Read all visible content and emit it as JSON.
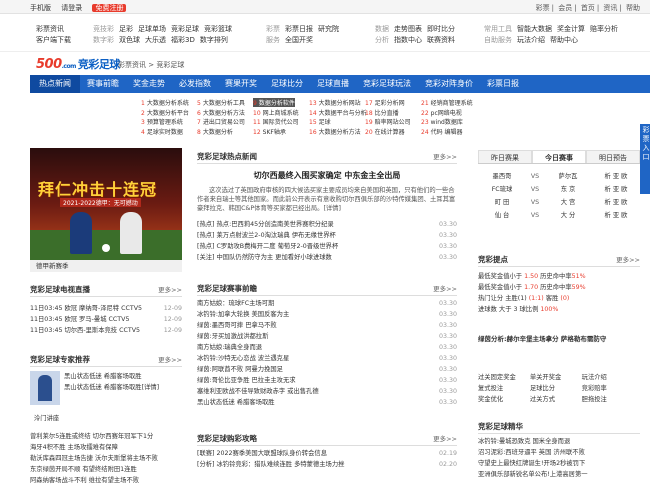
{
  "topbar": {
    "mobile": "手机版",
    "login": "请登录",
    "register": "免费注册",
    "right_links": [
      "彩票",
      "会员",
      "首页",
      "资讯",
      "帮助"
    ]
  },
  "nav2": {
    "g1": {
      "rows": [
        [
          "彩票资讯"
        ],
        [
          "客户端下载"
        ]
      ]
    },
    "g2": {
      "label": "竞技彩",
      "label2": "数字彩",
      "rows": [
        [
          "足彩",
          "足球单场",
          "竞彩足球",
          "竞彩篮球"
        ],
        [
          "双色球",
          "大乐透",
          "福彩3D",
          "数字排列"
        ]
      ]
    },
    "g3": {
      "label": "彩票",
      "label2": "服务",
      "rows": [
        [
          "彩票日报",
          "研究院"
        ],
        [
          "全国开奖"
        ]
      ]
    },
    "g4": {
      "label": "数据",
      "label2": "分析",
      "rows": [
        [
          "走势图表",
          "即时比分"
        ],
        [
          "指数中心",
          "联赛资料"
        ]
      ]
    },
    "g5": {
      "label": "常用工具",
      "label2": "自助服务",
      "rows": [
        [
          "智能大数据",
          "奖金计算",
          "赔率分析"
        ],
        [
          "玩法介绍",
          "帮助中心"
        ]
      ]
    }
  },
  "logo": {
    "num": "500",
    "suffix": ".com",
    "text": "竞彩足球"
  },
  "breadcrumb": "彩票资讯 > 竞彩足球",
  "mainnav": [
    "热点新闻",
    "赛事前瞻",
    "奖金走势",
    "必发指数",
    "赛果开奖",
    "足球比分",
    "足球直播",
    "竞彩足球玩法",
    "竞彩对阵身价",
    "彩票日报"
  ],
  "subgrid": [
    [
      "1",
      "大数据分析系统"
    ],
    [
      "5",
      "大数据分析工具"
    ],
    [
      "9",
      "数据分析软件"
    ],
    [
      "13",
      "大数据分析网站"
    ],
    [
      "17",
      "足彩分析网"
    ],
    [
      "21",
      "经销商管理系统"
    ],
    [
      "2",
      "大数据分析平台"
    ],
    [
      "6",
      "大数据分析方法"
    ],
    [
      "10",
      "网上商城系统"
    ],
    [
      "14",
      "大数据平台与分析"
    ],
    [
      "18",
      "比分直播"
    ],
    [
      "22",
      "pc网络电视"
    ],
    [
      "3",
      "预算管理系统"
    ],
    [
      "7",
      "进出口贸易公司"
    ],
    [
      "11",
      "国际货代公司"
    ],
    [
      "15",
      "足球"
    ],
    [
      "19",
      "赔率网站公司"
    ],
    [
      "23",
      "wind数据库"
    ],
    [
      "4",
      "足球实时数据"
    ],
    [
      "8",
      "大数据分析"
    ],
    [
      "12",
      "SKF轴承"
    ],
    [
      "16",
      "大数据分析方法"
    ],
    [
      "20",
      "在线计算器"
    ],
    [
      "24",
      "代码 编辑器"
    ]
  ],
  "side_right": "彩票入口",
  "banner": {
    "title": "拜仁冲击十连冠",
    "sub": "2021-2022德甲：无可撼动",
    "caption": "德甲新赛季"
  },
  "hotnews": {
    "title": "竞彩足球热点新闻",
    "more": "更多>>",
    "headline": "切尔西最终入围买家确定 中东金主全出局",
    "summary": "这次选过了英国政府审核的四大候选买家主要成员均来自美国和英国，只有他们的一些合作者来自瑞士等其他国家。而此前公开表示有意收购切尔西俱乐部的沙特传媒集团、土耳其富豪拜拉克、韩国C&P体育等买家都已经出局。[详情]",
    "items": [
      {
        "text": "[热点] 热点:巴西莉45分创造南美世界赛积分纪录",
        "date": "03.30"
      },
      {
        "text": "[热点] 莱万点射波兰2-0淘汰瑞典 伊布无缘世界杯",
        "date": "03.30"
      },
      {
        "text": "[热点] C罗助攻B费梅开二度 葡萄牙2-0晋级世界杯",
        "date": "03.30"
      },
      {
        "text": "[关注] 中国队仍然防守为主 更加看好小球进球数",
        "date": "03.30"
      }
    ]
  },
  "preview": {
    "title": "竞彩足球赛事前瞻",
    "more": "更多>>",
    "items": [
      {
        "text": "南方姑娘：琉球FC主场可期",
        "date": "03.30"
      },
      {
        "text": "冰钓铃:加拿大轮换 美国反客为主",
        "date": "03.30"
      },
      {
        "text": "绿茵:墨西哥可摔 巴拿马不败",
        "date": "03.30"
      },
      {
        "text": "绿茵:牙买加激战洪都拉斯",
        "date": "03.30"
      },
      {
        "text": "南方姑娘:瑞典全身而退",
        "date": "03.30"
      },
      {
        "text": "冰钓铃:沙特无心恋战 波兰遇克星",
        "date": "03.30"
      },
      {
        "text": "绿茵:阿联酋不败 阿曼力挽国足",
        "date": "03.30"
      },
      {
        "text": "绿茵:哥伦比亚争胜 巴拉圭主攻无求",
        "date": "03.30"
      },
      {
        "text": "塞维利亚欧战不佳导致财政赤字 或出售孔德",
        "date": "03.30"
      },
      {
        "text": "黑山状态低迷 希腊客场取胜",
        "date": "03.30"
      }
    ]
  },
  "buytips": {
    "title": "竞彩足球购彩攻略",
    "more": "更多>>",
    "items": [
      {
        "text": "[联赛] 2022赛季美国大联盟球队身价转会信息",
        "date": "02.19"
      },
      {
        "text": "[分析] 冰钓铃竞彩：猎队难续连胜 多特蒙德主场力挫",
        "date": "02.20"
      }
    ]
  },
  "live": {
    "title": "竞彩足球电视直播",
    "more": "更多>>",
    "items": [
      {
        "text": "11日03:45 欧冠 摩纳哥-泽尼特 CCTV5",
        "date": "12-09"
      },
      {
        "text": "11日03:45 欧冠 罗马-曼城 CCTV5",
        "date": "12-09"
      },
      {
        "text": "11日03:45 切尔西-里斯本竞技 CCTV5",
        "date": "12-09"
      }
    ]
  },
  "expert": {
    "title": "竞彩足球专家推荐",
    "more": "更多>>",
    "pic_name": "泠门讲座",
    "pic_info": [
      "黑山状态低迷 希腊客场取胜",
      "黑山状态低迷 希腊客场取胜[详情]"
    ],
    "items": [
      "曾利莱尔5连胜或终结 切尔西赛年冠军下1分",
      "海牙4积不胜 主场攻擂难有保障",
      "勒沃库森四冠主场告捷 沃尔夫斯堡将主场不败",
      "东京绿茵开局不顺 有望终结附田1连胜",
      "阿森纳客场战斗不利 维拉有望主场不败"
    ]
  },
  "fixtures": {
    "tabs": [
      "昨日赛果",
      "今日赛事",
      "明日预告"
    ],
    "active": 1,
    "matches": [
      [
        "墨西哥",
        "VS",
        "萨尔瓦",
        "析 亚 欧"
      ],
      [
        "FC琉球",
        "VS",
        "东 京",
        "析 亚 欧"
      ],
      [
        "町 田",
        "VS",
        "大 宫",
        "析 亚 欧"
      ],
      [
        "仙 台",
        "VS",
        "大 分",
        "析 亚 欧"
      ]
    ]
  },
  "tips": {
    "title": "竞彩提点",
    "more": "更多>>",
    "items": [
      {
        "pre": "最低奖金值小于 ",
        "red": "1.50",
        "post": " 历史命中率",
        "pct": "51%"
      },
      {
        "pre": "最低奖金值小于 ",
        "red": "1.70",
        "post": " 历史命中率",
        "pct": "59%"
      },
      {
        "pre": "热门让分 主胜(1)  ",
        "red": "(1:1)",
        "post": " 客胜 ",
        "pct": "(0)"
      },
      {
        "pre": "进球数 大于 3 球比例 ",
        "red": "",
        "post": "",
        "pct": "100%"
      }
    ]
  },
  "featured": "绿茵分析:赫尔辛堡主场拿分 萨格勒布需防守",
  "quick": [
    "过关固定奖金",
    "单关开奖金",
    "玩法介绍",
    "复式投注",
    "足球比分",
    "竞彩赔率",
    "奖金优化",
    "过关方式",
    "胆拖投注"
  ],
  "essence": {
    "title": "竞彩足球精华",
    "items": [
      "冰钓铃:曼城恐致克 国米全身而退",
      "沼习泥彩:西班牙逼平 英国 济州联不败",
      "守望史上最快红牌诞生!开场2秒被罚下",
      "亚洲俱乐部新锐名单公布!上港高居第一"
    ]
  }
}
